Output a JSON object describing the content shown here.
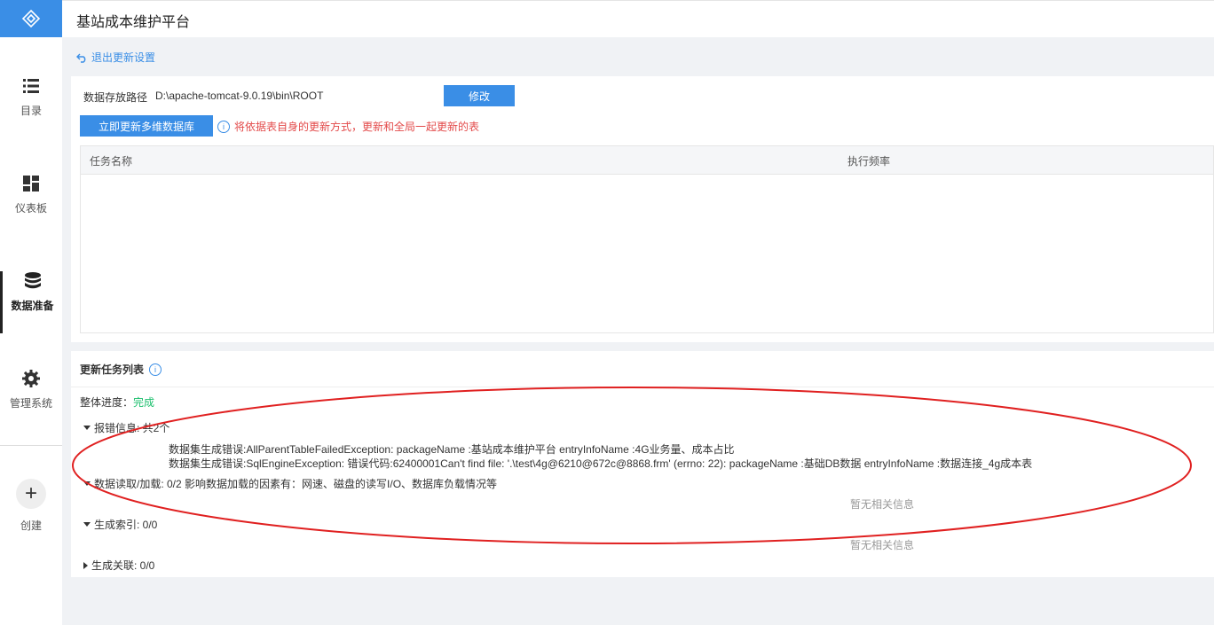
{
  "sidebar": {
    "logo_icon": "diamond-logo-icon",
    "items": [
      {
        "label": "目录",
        "icon": "list-icon"
      },
      {
        "label": "仪表板",
        "icon": "dashboard-icon"
      },
      {
        "label": "数据准备",
        "icon": "database-icon",
        "active": true
      },
      {
        "label": "管理系统",
        "icon": "gear-icon"
      }
    ],
    "create_label": "创建",
    "create_icon": "plus-icon"
  },
  "header": {
    "title": "基站成本维护平台"
  },
  "back_link": "退出更新设置",
  "settings": {
    "path_label": "数据存放路径",
    "path_value": "D:\\apache-tomcat-9.0.19\\bin\\ROOT",
    "modify_button": "修改",
    "update_button": "立即更新多维数据库",
    "hint": "将依据表自身的更新方式，更新和全局一起更新的表",
    "table_headers": [
      "任务名称",
      "执行频率"
    ]
  },
  "task_list": {
    "title": "更新任务列表",
    "progress_label": "整体进度：",
    "progress_status": "完成",
    "errors_header": "报错信息: 共2个",
    "errors": [
      "数据集生成错误:AllParentTableFailedException: packageName :基站成本维护平台 entryInfoName :4G业务量、成本占比",
      "数据集生成错误:SqlEngineException: 错误代码:62400001Can't find file: '.\\test\\4g@6210@672c@8868.frm' (errno: 22): packageName :基础DB数据 entryInfoName :数据连接_4g成本表"
    ],
    "load_header": "数据读取/加载: 0/2 影响数据加载的因素有：网速、磁盘的读写I/O、数据库负载情况等",
    "load_empty": "暂无相关信息",
    "index_header": "生成索引: 0/0",
    "index_empty": "暂无相关信息",
    "relation_header": "生成关联: 0/0"
  },
  "colors": {
    "accent": "#3a8ee6",
    "error": "#e34a4a",
    "success": "#19be6b",
    "annotation": "#e02020"
  }
}
